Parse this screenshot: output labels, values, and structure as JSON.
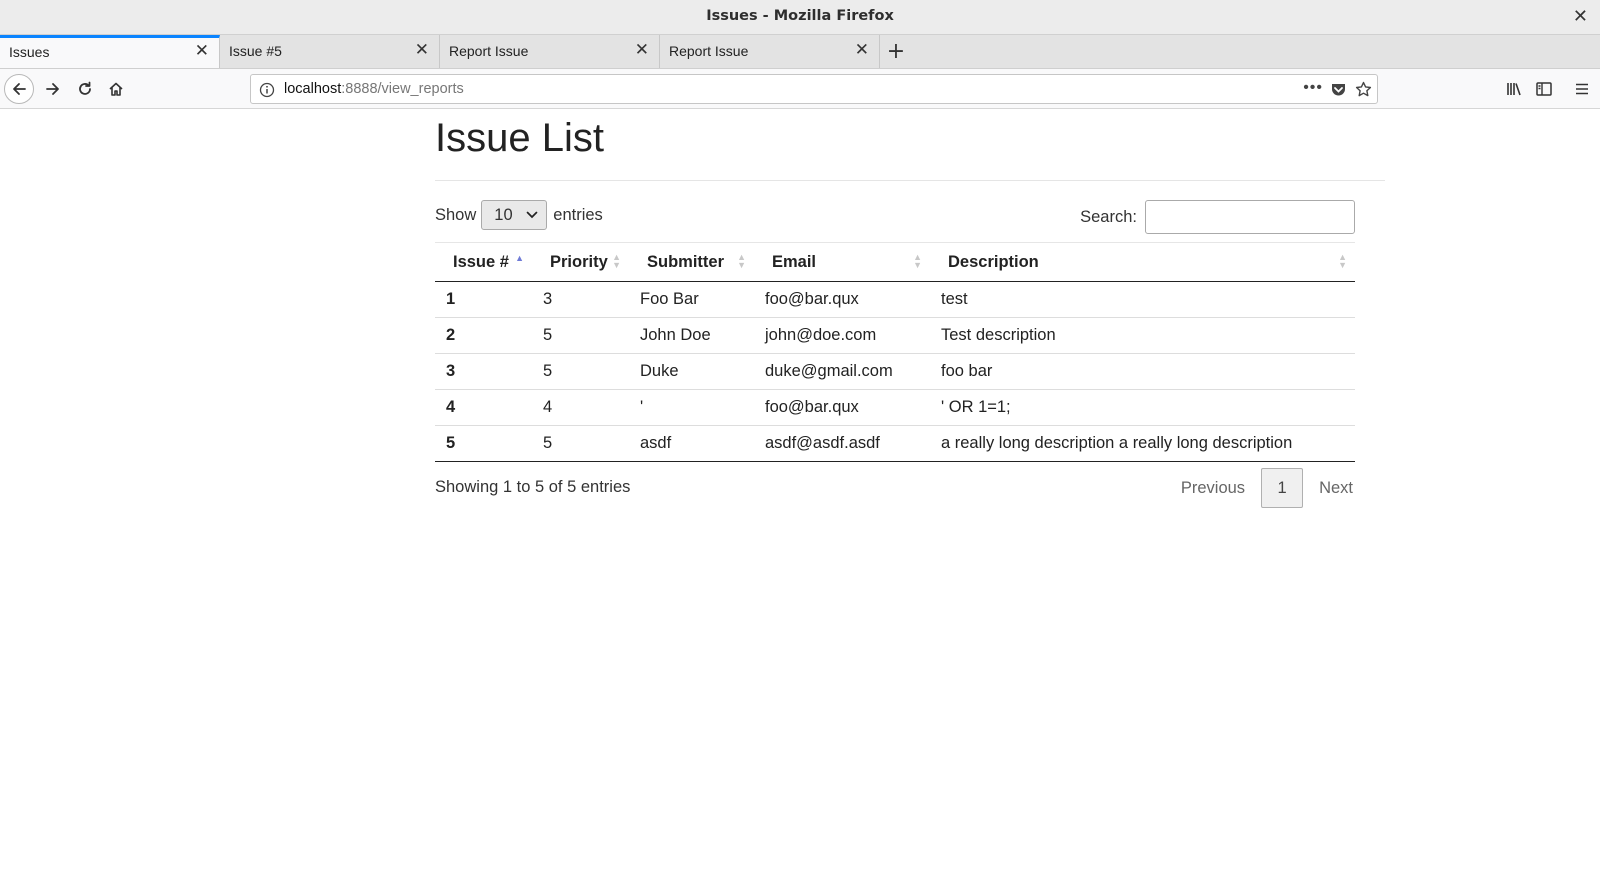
{
  "window": {
    "title": "Issues - Mozilla Firefox"
  },
  "tabs": [
    {
      "label": "Issues",
      "active": true
    },
    {
      "label": "Issue #5",
      "active": false
    },
    {
      "label": "Report Issue",
      "active": false
    },
    {
      "label": "Report Issue",
      "active": false
    }
  ],
  "nav": {
    "url_host": "localhost",
    "url_rest": ":8888/view_reports"
  },
  "page": {
    "heading": "Issue List",
    "length": {
      "prefix": "Show",
      "value": "10",
      "suffix": "entries"
    },
    "search_label": "Search:",
    "search_value": "",
    "columns": [
      "Issue #",
      "Priority",
      "Submitter",
      "Email",
      "Description"
    ],
    "sort_column": "Issue #",
    "rows": [
      {
        "id": "1",
        "priority": "3",
        "submitter": "Foo Bar",
        "email": "foo@bar.qux",
        "description": "test"
      },
      {
        "id": "2",
        "priority": "5",
        "submitter": "John Doe",
        "email": "john@doe.com",
        "description": "Test description"
      },
      {
        "id": "3",
        "priority": "5",
        "submitter": "Duke",
        "email": "duke@gmail.com",
        "description": "foo bar"
      },
      {
        "id": "4",
        "priority": "4",
        "submitter": "'",
        "email": "foo@bar.qux",
        "description": "' OR 1=1;"
      },
      {
        "id": "5",
        "priority": "5",
        "submitter": "asdf",
        "email": "asdf@asdf.asdf",
        "description": "a really long description a really long description"
      }
    ],
    "info": "Showing 1 to 5 of 5 entries",
    "pagination": {
      "previous": "Previous",
      "current": "1",
      "next": "Next"
    }
  },
  "colors": {
    "accent": "#0a84ff",
    "sort_active": "#6f7bd6"
  }
}
